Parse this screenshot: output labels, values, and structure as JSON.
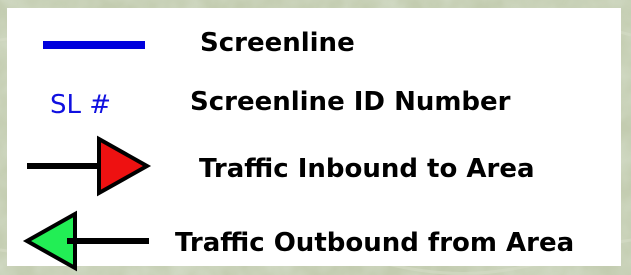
{
  "legend": {
    "items": [
      {
        "symbol": "blue-line",
        "label": "Screenline"
      },
      {
        "symbol": "sl-id-text",
        "symbol_text": "SL #",
        "label": "Screenline ID Number"
      },
      {
        "symbol": "inbound-arrow",
        "label": "Traffic Inbound to Area"
      },
      {
        "symbol": "outbound-arrow",
        "label": "Traffic Outbound from Area"
      }
    ]
  },
  "colors": {
    "screenline": "#0000dd",
    "sl_id_text": "#1010e0",
    "inbound_arrow": "#ee1111",
    "outbound_arrow": "#22ee55",
    "arrow_shaft": "#000000",
    "map_background": "#b9c3a6"
  }
}
